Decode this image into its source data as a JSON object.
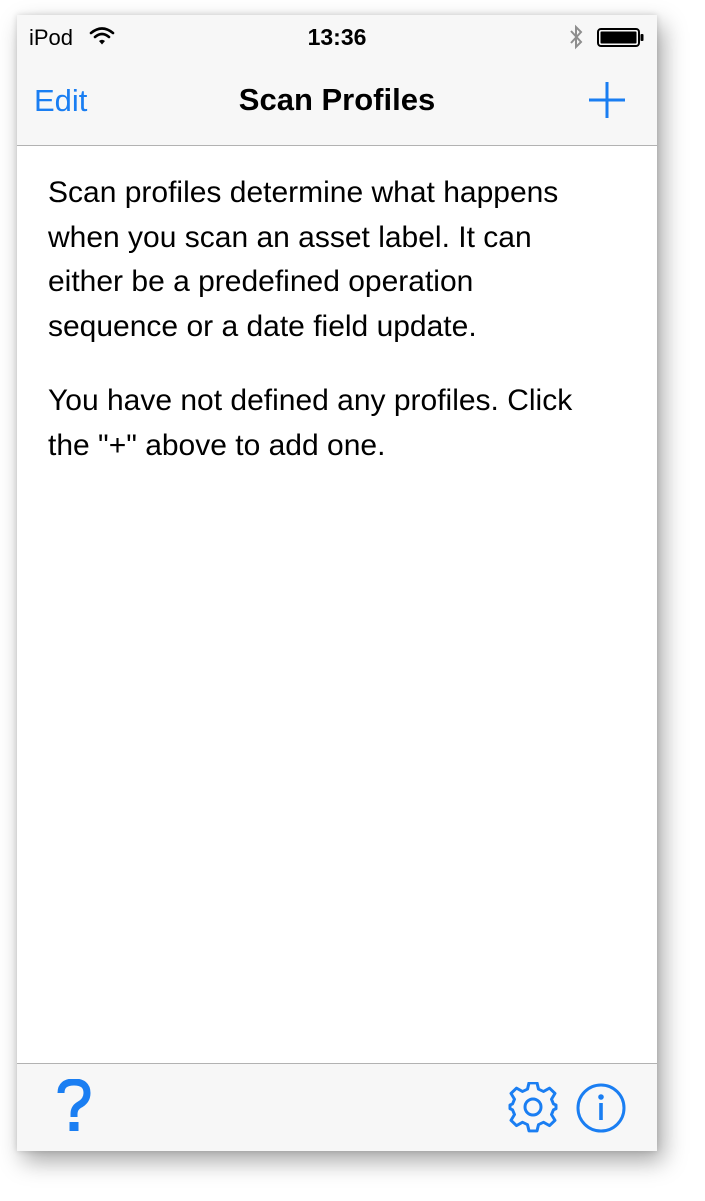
{
  "status_bar": {
    "carrier": "iPod",
    "time": "13:36",
    "icons": [
      "wifi-icon",
      "bluetooth-icon",
      "battery-icon"
    ]
  },
  "nav_bar": {
    "edit_label": "Edit",
    "title": "Scan Profiles",
    "add_icon": "plus-icon"
  },
  "content": {
    "paragraphs": [
      "Scan profiles determine what happens when you scan an asset label. It can either be a predefined operation sequence or a date field update.",
      "You have not defined any profiles. Click the \"+\" above to add one."
    ]
  },
  "tab_bar": {
    "items": [
      "help-icon",
      "gear-icon",
      "info-icon"
    ]
  },
  "colors": {
    "accent": "#1a7ef2",
    "bar_background": "#f7f7f7",
    "separator": "#b2b2b2",
    "text": "#000000"
  }
}
